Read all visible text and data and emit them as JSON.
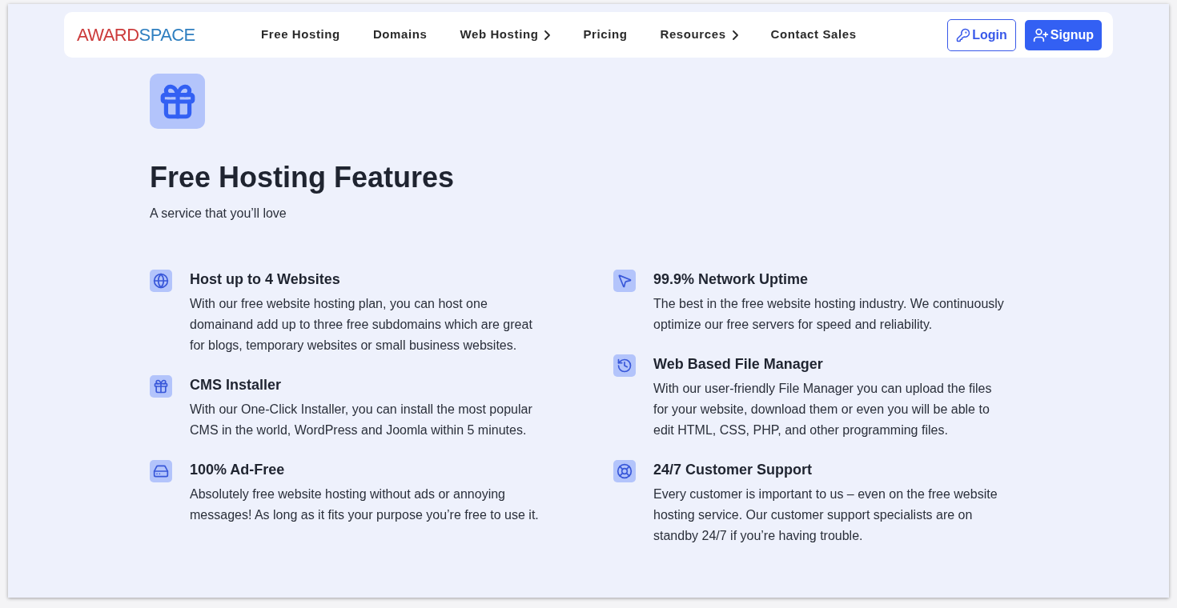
{
  "logo": {
    "part_1": "AWARD",
    "part_2": "SPACE"
  },
  "nav": [
    {
      "label": "Free Hosting",
      "has_submenu": false
    },
    {
      "label": "Domains",
      "has_submenu": false
    },
    {
      "label": "Web Hosting",
      "has_submenu": true
    },
    {
      "label": "Pricing",
      "has_submenu": false
    },
    {
      "label": "Resources",
      "has_submenu": true
    },
    {
      "label": "Contact Sales",
      "has_submenu": false
    }
  ],
  "login_button": "Login",
  "signup_button": "Signup",
  "hero": {
    "title": "Free Hosting Features",
    "subtitle": "A service that you’ll love"
  },
  "features": [
    [
      {
        "kind": "globe",
        "title": "Host up to 4 Websites",
        "text": "With our free website hosting plan, you can host one domainand add up to three free subdomains which are great for blogs, temporary websites or small business websites."
      },
      {
        "kind": "gift",
        "title": "CMS Installer",
        "text": "With our One-Click Installer, you can install the most popular CMS in the world, WordPress and Joomla within 5 minutes."
      },
      {
        "kind": "drive",
        "title": "100% Ad-Free",
        "text": "Absolutely free website hosting without ads or annoying messages! As long as it fits your purpose you’re free to use it."
      }
    ],
    [
      {
        "kind": "cursor",
        "title": "99.9% Network Uptime",
        "text": "The best in the free website hosting industry. We continuously optimize our free servers for speed and reliability."
      },
      {
        "kind": "history",
        "title": "Web Based File Manager",
        "text": "With our user-friendly File Manager you can upload the files for your website, download them or even you will be able to edit HTML, CSS, PHP, and other programming files."
      },
      {
        "kind": "lifebuoy",
        "title": "24/7 Customer Support",
        "text": "Every customer is important to us – even on the free website hosting service. Our customer support specialists are on standby 24/7 if you’re having trouble."
      }
    ]
  ]
}
